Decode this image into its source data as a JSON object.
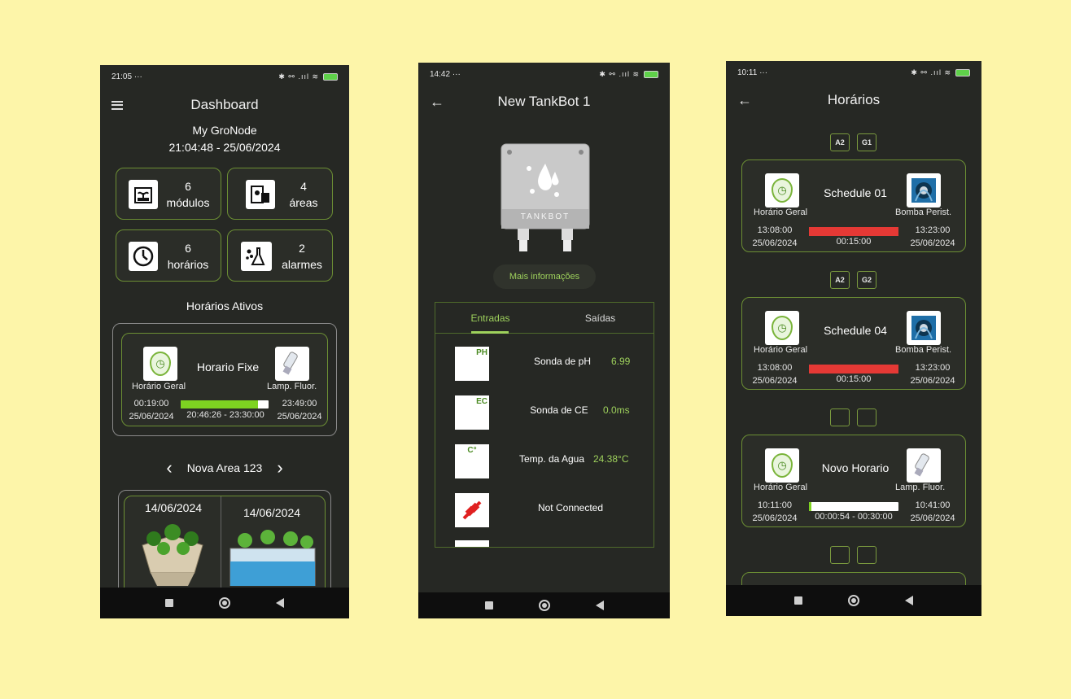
{
  "p1": {
    "status_time": "21:05",
    "status_dots": "···",
    "status_icons": "✱ ⚯ .ııl ≋",
    "title": "Dashboard",
    "device_name": "My GroNode",
    "datetime": "21:04:48 - 25/06/2024",
    "tiles": [
      {
        "count": "6",
        "label": "módulos",
        "icon": "module-icon"
      },
      {
        "count": "4",
        "label": "áreas",
        "icon": "area-icon"
      },
      {
        "count": "6",
        "label": "horários",
        "icon": "clock-icon"
      },
      {
        "count": "2",
        "label": "alarmes",
        "icon": "flask-icon"
      }
    ],
    "active_section_title": "Horários Ativos",
    "active_card": {
      "name": "Horario Fixe",
      "left_label": "Horário Geral",
      "right_label": "Lamp. Fluor.",
      "start_time": "00:19:00",
      "start_date": "25/06/2024",
      "end_time": "23:49:00",
      "end_date": "25/06/2024",
      "range": "20:46:26 - 23:30:00",
      "progress": 0.88,
      "progress_color": "#7ed321"
    },
    "area_nav": {
      "prev": "‹",
      "name": "Nova Area 123",
      "next": "›"
    },
    "area_cards": [
      {
        "date": "14/06/2024"
      },
      {
        "date": "14/06/2024"
      }
    ]
  },
  "p2": {
    "status_time": "14:42",
    "status_dots": "···",
    "status_icons": "✱ ⚯ .ııl ≋",
    "back": "←",
    "title": "New TankBot 1",
    "device_label": "TANKBOT",
    "info_button": "Mais informações",
    "tabs": [
      {
        "label": "Entradas",
        "active": true
      },
      {
        "label": "Saídas",
        "active": false
      }
    ],
    "sensors": [
      {
        "name": "Sonda de pH",
        "value": "6.99",
        "icon": "ph-sensor-icon",
        "icon_text": "PH"
      },
      {
        "name": "Sonda de CE",
        "value": "0.0ms",
        "icon": "ec-sensor-icon",
        "icon_text": "EC"
      },
      {
        "name": "Temp. da Agua",
        "value": "24.38°C",
        "icon": "temperature-icon",
        "icon_text": "C°"
      },
      {
        "name": "Not Connected",
        "value": "",
        "icon": "unplugged-icon",
        "icon_text": ""
      }
    ],
    "accent": "#9ed15c"
  },
  "p3": {
    "status_time": "10:11",
    "status_dots": "···",
    "status_icons": "✱ ⚯ .ııl ≋",
    "back": "←",
    "title": "Horários",
    "schedules": [
      {
        "tags": [
          "A2",
          "G1"
        ],
        "name": "Schedule 01",
        "left_label": "Horário Geral",
        "right_label": "Bomba Perist.",
        "start_time": "13:08:00",
        "start_date": "25/06/2024",
        "end_time": "13:23:00",
        "end_date": "25/06/2024",
        "center": "00:15:00",
        "bar_color": "#e53935",
        "progress": 1.0,
        "right_icon": "pump-icon"
      },
      {
        "tags": [
          "A2",
          "G2"
        ],
        "name": "Schedule 04",
        "left_label": "Horário Geral",
        "right_label": "Bomba Perist.",
        "start_time": "13:08:00",
        "start_date": "25/06/2024",
        "end_time": "13:23:00",
        "end_date": "25/06/2024",
        "center": "00:15:00",
        "bar_color": "#e53935",
        "progress": 1.0,
        "right_icon": "pump-icon"
      },
      {
        "tags": [
          "",
          ""
        ],
        "name": "Novo Horario",
        "left_label": "Horário Geral",
        "right_label": "Lamp. Fluor.",
        "start_time": "10:11:00",
        "start_date": "25/06/2024",
        "end_time": "10:41:00",
        "end_date": "25/06/2024",
        "center": "00:00:54 - 00:30:00",
        "bar_color": "#7ed321",
        "progress": 0.03,
        "right_icon": "lamp-icon"
      }
    ],
    "trailing_tags": [
      "",
      ""
    ]
  }
}
